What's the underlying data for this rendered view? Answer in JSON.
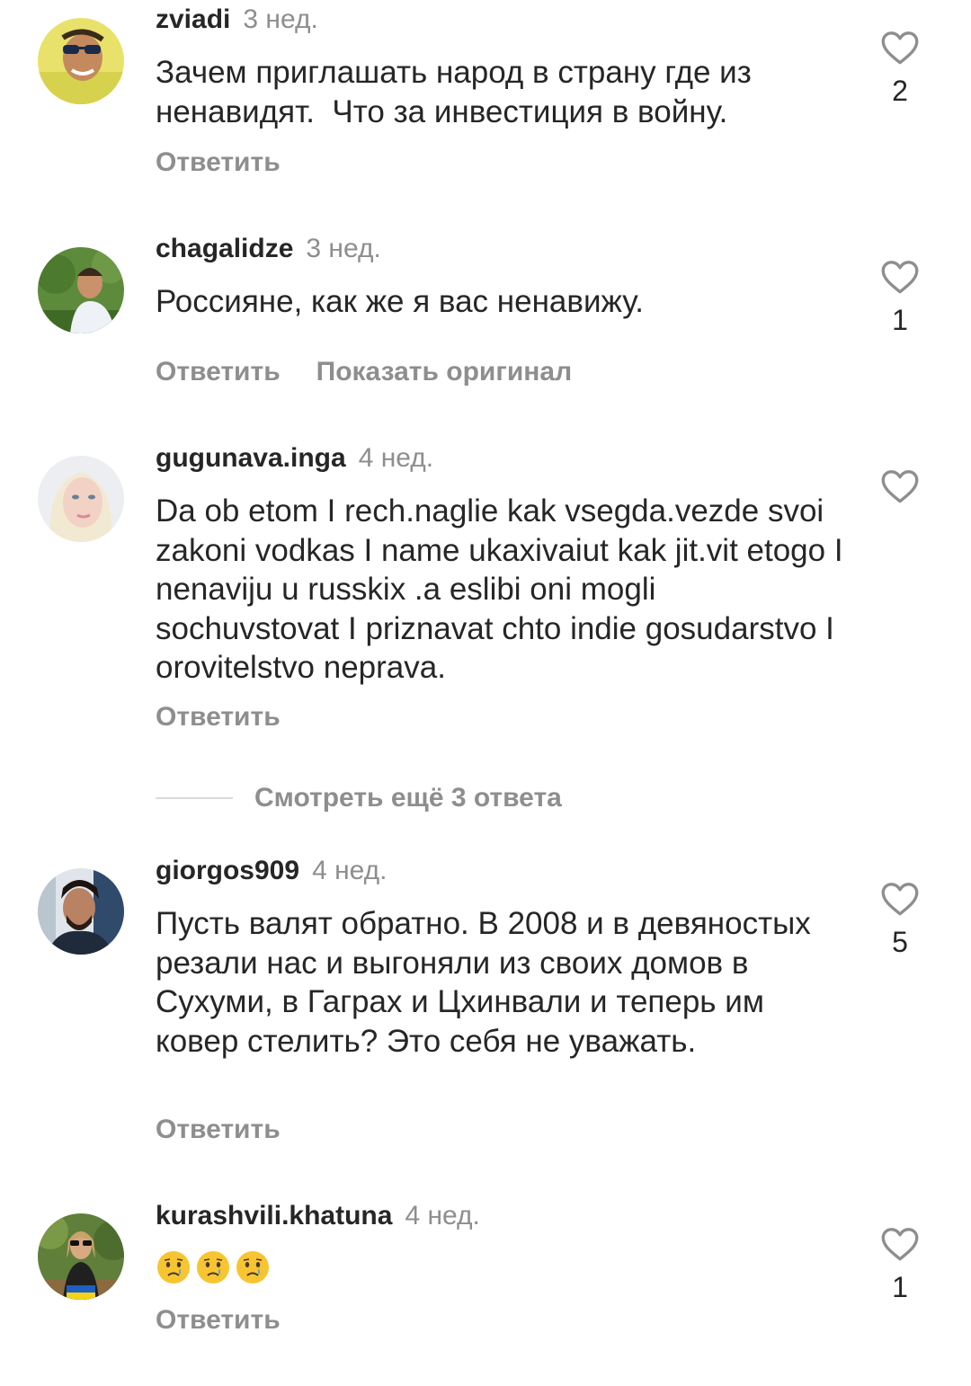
{
  "comments": [
    {
      "username": "zviadi",
      "time": "3 нед.",
      "text": "Зачем приглашать народ в страну где из ненавидят.  Что за инвестиция в войну.",
      "likes": "2",
      "reply_label": "Ответить",
      "avatar_icon": "avatar-photo-sunglasses"
    },
    {
      "username": "chagalidze",
      "time": "3 нед.",
      "text": "Россияне, как же я вас ненавижу.",
      "likes": "1",
      "reply_label": "Ответить",
      "show_original_label": "Показать оригинал",
      "avatar_icon": "avatar-photo-man-outdoors"
    },
    {
      "username": "gugunava.inga",
      "time": "4 нед.",
      "text": "Da ob etom I rech.naglie kak vsegda.vezde svoi zakoni vodkas I name ukaxivaiut kak jit.vit etogo I nenaviju u russkix .a eslibi oni mogli sochuvstovat I priznavat chto indie gosudarstvo I orovitelstvo neprava.",
      "likes": "",
      "reply_label": "Ответить",
      "avatar_icon": "avatar-photo-woman-blonde"
    },
    {
      "username": "giorgos909",
      "time": "4 нед.",
      "text": "Пусть валят обратно. В 2008 и в девяностых резали нас и выгоняли из своих домов в Сухуми, в Гаграх и Цхинвали и теперь им ковер стелить? Это себя не уважать.",
      "likes": "5",
      "reply_label": "Ответить",
      "avatar_icon": "avatar-photo-man-beard"
    },
    {
      "username": "kurashvili.khatuna",
      "time": "4 нед.",
      "text": "",
      "emojis": [
        "crying-face-emoji",
        "crying-face-emoji",
        "crying-face-emoji"
      ],
      "likes": "1",
      "reply_label": "Ответить",
      "avatar_icon": "avatar-photo-woman-garden"
    }
  ],
  "more_replies": {
    "label": "Смотреть ещё 3 ответа"
  },
  "colors": {
    "primary_text": "#262626",
    "secondary_text": "#8e8e8e",
    "divider": "#dbdbdb",
    "background": "#ffffff"
  },
  "icons": {
    "like": "heart-outline-icon"
  }
}
